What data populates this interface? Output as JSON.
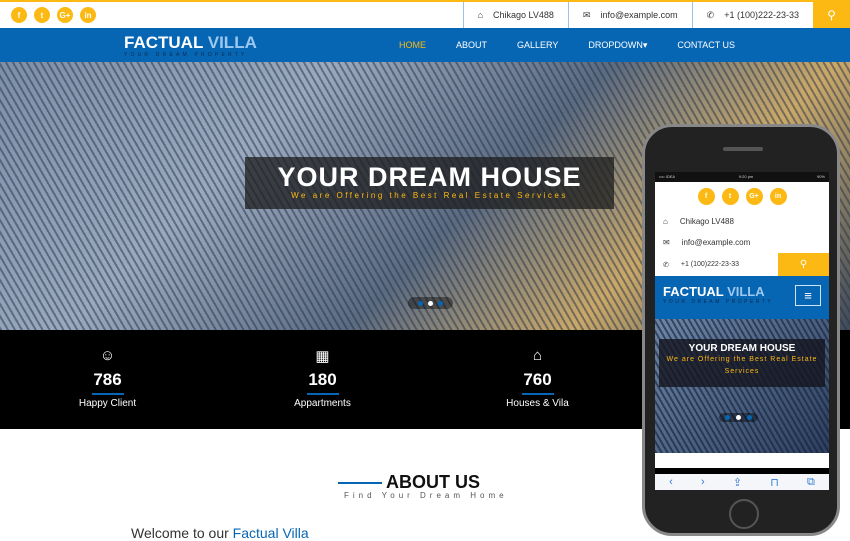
{
  "topbar": {
    "social": [
      "f",
      "t",
      "G+",
      "in"
    ],
    "address": "Chikago LV488",
    "email": "info@example.com",
    "phone": "+1 (100)222-23-33"
  },
  "nav": {
    "brand_main": "FACTUAL",
    "brand_accent": "VILLA",
    "tagline": "YOUR DREAM PROPERTY",
    "menu": [
      "HOME",
      "ABOUT",
      "GALLERY",
      "DROPDOWN▾",
      "CONTACT US"
    ]
  },
  "hero": {
    "title": "YOUR DREAM HOUSE",
    "subtitle": "We are Offering the Best Real Estate Services"
  },
  "stats": [
    {
      "value": "786",
      "label": "Happy Client"
    },
    {
      "value": "180",
      "label": "Appartments"
    },
    {
      "value": "760",
      "label": "Houses & Vila"
    }
  ],
  "about": {
    "title": "ABOUT US",
    "subtitle": "Find Your Dream Home",
    "welcome": "Welcome to our",
    "welcome_accent": "Factual Villa"
  },
  "phone": {
    "carrier": "•••• IDEA",
    "time": "9:20 pm",
    "battery": "90%",
    "title": "YOUR DREAM HOUSE",
    "subtitle": "We are Offering the Best Real Estate Services"
  },
  "colors": {
    "accent": "#fdb913",
    "brand": "#0766b4"
  }
}
